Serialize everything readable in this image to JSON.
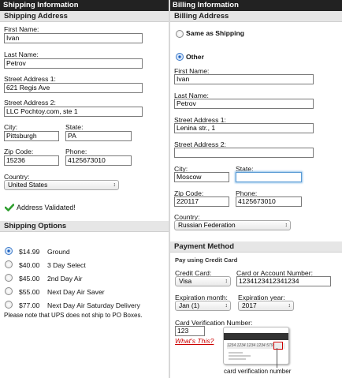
{
  "header": {
    "shipping_info": "Shipping Information",
    "billing_info": "Billing Information"
  },
  "shipping_address": {
    "title": "Shipping Address",
    "first_name_label": "First Name:",
    "first_name": "Ivan",
    "last_name_label": "Last Name:",
    "last_name": "Petrov",
    "street1_label": "Street Address 1:",
    "street1": "621 Regis Ave",
    "street2_label": "Street Address 2:",
    "street2": "LLC Pochtoy.com, ste 1",
    "city_label": "City:",
    "city": "Pittsburgh",
    "state_label": "State:",
    "state": "PA",
    "zip_label": "Zip Code:",
    "zip": "15236",
    "phone_label": "Phone:",
    "phone": "4125673010",
    "country_label": "Country:",
    "country": "United States",
    "validated": "Address Validated!"
  },
  "shipping_options": {
    "title": "Shipping Options",
    "options": [
      {
        "price": "$14.99",
        "name": "Ground",
        "selected": true
      },
      {
        "price": "$40.00",
        "name": "3 Day Select",
        "selected": false
      },
      {
        "price": "$45.00",
        "name": "2nd Day Air",
        "selected": false
      },
      {
        "price": "$55.00",
        "name": "Next Day Air Saver",
        "selected": false
      },
      {
        "price": "$77.00",
        "name": "Next Day Air Saturday Delivery",
        "selected": false
      }
    ],
    "note": "Please note that UPS does not ship to PO Boxes."
  },
  "billing_address": {
    "title": "Billing Address",
    "same_as_shipping": "Same as Shipping",
    "other": "Other",
    "selected": "other",
    "first_name_label": "First Name:",
    "first_name": "Ivan",
    "last_name_label": "Last Name:",
    "last_name": "Petrov",
    "street1_label": "Street Address 1:",
    "street1": "Lenina str., 1",
    "street2_label": "Street Address 2:",
    "street2": "",
    "city_label": "City:",
    "city": "Moscow",
    "state_label": "State:",
    "state": "",
    "zip_label": "Zip Code:",
    "zip": "220117",
    "phone_label": "Phone:",
    "phone": "4125673010",
    "country_label": "Country:",
    "country": "Russian Federation"
  },
  "payment": {
    "title": "Payment Method",
    "subtitle": "Pay using Credit Card",
    "card_label": "Credit Card:",
    "card": "Visa",
    "account_label": "Card or Account Number:",
    "account": "1234123412341234",
    "exp_month_label": "Expiration month:",
    "exp_month": "Jan (1)",
    "exp_year_label": "Expiration year:",
    "exp_year": "2017",
    "cvv_label": "Card Verification Number:",
    "cvv": "123",
    "whats_this": "What's This?",
    "card_sample_number": "1234 1234 1234 1234",
    "card_sample_cvv": "579",
    "cvv_caption": "card verification number"
  },
  "colors": {
    "header_bg": "#222222",
    "section_bg": "#e6e6e6",
    "check_green": "#2e9e2e",
    "link_red": "#cc0000",
    "radio_blue": "#1b5fbf"
  }
}
